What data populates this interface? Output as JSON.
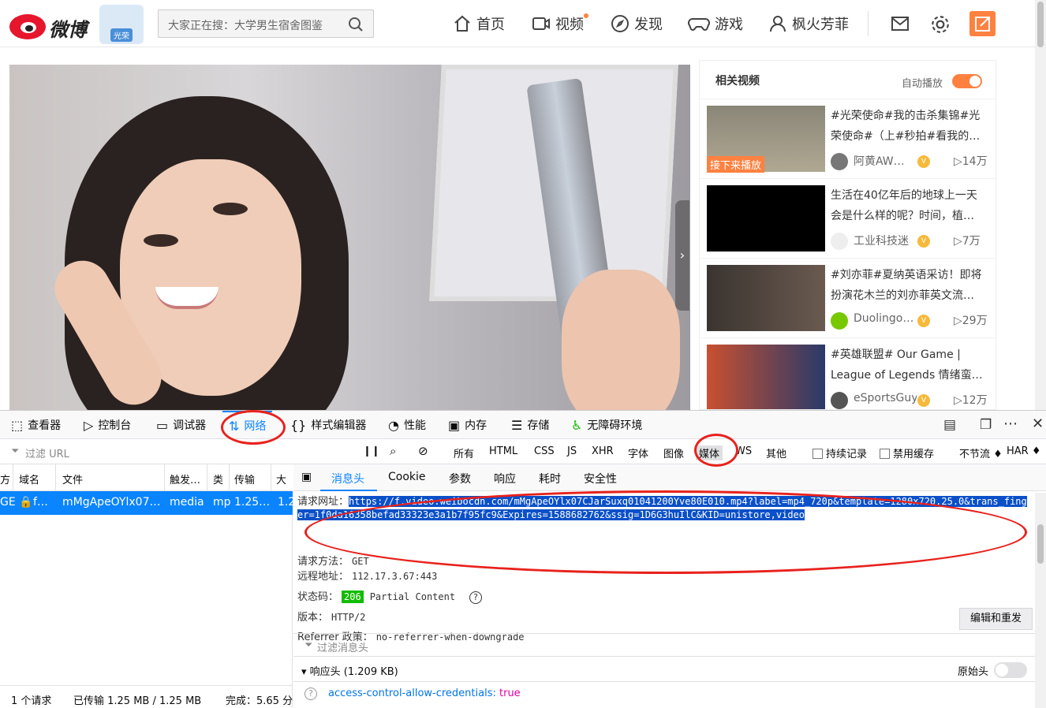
{
  "weibo": {
    "logo_text": "微博",
    "mascot_label": "光荣",
    "search_placeholder": "大家正在搜：大学男生宿舍图鉴",
    "nav": [
      "首页",
      "视频",
      "发现",
      "游戏",
      "枫火芳菲"
    ],
    "video_arrow": "›"
  },
  "related": {
    "title": "相关视频",
    "autoplay_label": "自动播放",
    "autoplay_on": true,
    "items": [
      {
        "title": "#光荣使命#我的击杀集锦#光荣使命#（上#秒拍#看我的…",
        "author": "阿黄AW…",
        "plays": "▷14万",
        "badge": "接下来播放"
      },
      {
        "title": "生活在40亿年后的地球上一天会是什么样的呢？时间，植…",
        "author": "工业科技迷",
        "plays": "▷7万",
        "badge": ""
      },
      {
        "title": "#刘亦菲#夏纳英语采访！即将扮演花木兰的刘亦菲英文流…",
        "author": "Duolingo…",
        "plays": "▷29万",
        "badge": ""
      },
      {
        "title": "#英雄联盟# Our Game | League of Legends 情绪蛮…",
        "author": "eSportsGuy",
        "plays": "▷12万",
        "badge": ""
      }
    ],
    "verified_mark": "V"
  },
  "devtools": {
    "tabs": [
      "查看器",
      "控制台",
      "调试器",
      "网络",
      "样式编辑器",
      "性能",
      "内存",
      "存储",
      "无障碍环境"
    ],
    "filter_url_placeholder": "过滤 URL",
    "type_filters": [
      "所有",
      "HTML",
      "CSS",
      "JS",
      "XHR",
      "字体",
      "图像",
      "媒体",
      "WS",
      "其他"
    ],
    "persist_label": "持续记录",
    "disable_cache_label": "禁用缓存",
    "throttle_label": "不节流 ♦",
    "har_label": "HAR ♦",
    "columns": [
      "方",
      "域名",
      "文件",
      "触发…",
      "类",
      "传输",
      "大"
    ],
    "request_row": {
      "method": "GE",
      "domain": "f…",
      "file": "mMgApeOYlx07…",
      "cause": "media",
      "type": "mp",
      "transferred": "1.25…",
      "size": "1.2"
    },
    "status": {
      "requests": "1 个请求",
      "transferred": "已传输 1.25 MB / 1.25 MB",
      "finish": "完成：5.65 分"
    },
    "detail_tabs": [
      "消息头",
      "Cookie",
      "参数",
      "响应",
      "耗时",
      "安全性"
    ],
    "request_url_label": "请求网址：",
    "request_url": "https://f.video.weibocdn.com/mMgApeOYlx07CJarSuxq01041200Yve80E010.mp4?label=mp4_720p&template=1280x720.25.0&trans_finger=1f0da16358befad33323e3a1b7f95fc9&Expires=1588682762&ssig=1D6G3huIlC&KID=unistore,video",
    "method_label": "请求方法：",
    "method": "GET",
    "remote_label": "远程地址：",
    "remote": "112.17.3.67:443",
    "status_label": "状态码：",
    "status_code": "206",
    "status_text": "Partial Content",
    "version_label": "版本：",
    "version": "HTTP/2",
    "referrer_label": "Referrer 政策：",
    "referrer": "no-referrer-when-downgrade",
    "edit_resend": "编辑和重发",
    "filter_headers": "过滤消息头",
    "response_headers": "响应头 (1.209 KB)",
    "raw_headers": "原始头",
    "header_key": "access-control-allow-credentials:",
    "header_value": "true"
  },
  "colors": {
    "accent": "#0a84ff",
    "weibo_orange": "#ff8140",
    "annotation": "#e8221d",
    "status_ok": "#12bc00"
  }
}
